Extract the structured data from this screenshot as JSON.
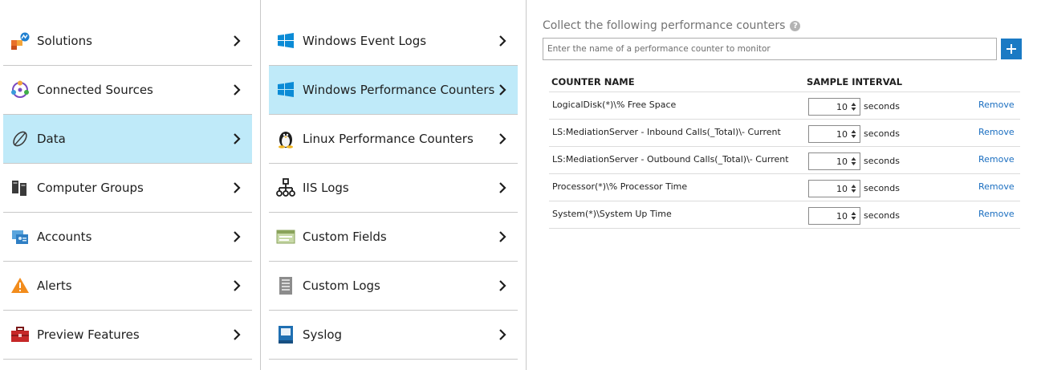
{
  "left_menu": {
    "items": [
      {
        "label": "Solutions",
        "icon": "solutions-icon"
      },
      {
        "label": "Connected Sources",
        "icon": "connected-sources-icon"
      },
      {
        "label": "Data",
        "icon": "data-icon",
        "selected": true
      },
      {
        "label": "Computer Groups",
        "icon": "computer-groups-icon"
      },
      {
        "label": "Accounts",
        "icon": "accounts-icon"
      },
      {
        "label": "Alerts",
        "icon": "alerts-icon"
      },
      {
        "label": "Preview Features",
        "icon": "preview-features-icon"
      }
    ]
  },
  "data_menu": {
    "items": [
      {
        "label": "Windows Event Logs",
        "icon": "windows-logo-icon"
      },
      {
        "label": "Windows Performance Counters",
        "icon": "windows-logo-icon",
        "selected": true
      },
      {
        "label": "Linux Performance Counters",
        "icon": "linux-penguin-icon"
      },
      {
        "label": "IIS Logs",
        "icon": "iis-logs-icon"
      },
      {
        "label": "Custom Fields",
        "icon": "custom-fields-icon"
      },
      {
        "label": "Custom Logs",
        "icon": "custom-logs-icon"
      },
      {
        "label": "Syslog",
        "icon": "syslog-icon"
      }
    ]
  },
  "counters_panel": {
    "title": "Collect the following performance counters",
    "search_placeholder": "Enter the name of a performance counter to monitor",
    "add_label": "+",
    "columns": {
      "name": "COUNTER NAME",
      "interval": "SAMPLE INTERVAL"
    },
    "rows": [
      {
        "name": "LogicalDisk(*)\\% Free Space",
        "interval": "10",
        "unit": "seconds",
        "action": "Remove"
      },
      {
        "name": "LS:MediationServer - Inbound Calls(_Total)\\- Current",
        "interval": "10",
        "unit": "seconds",
        "action": "Remove"
      },
      {
        "name": "LS:MediationServer - Outbound Calls(_Total)\\- Current",
        "interval": "10",
        "unit": "seconds",
        "action": "Remove"
      },
      {
        "name": "Processor(*)\\% Processor Time",
        "interval": "10",
        "unit": "seconds",
        "action": "Remove"
      },
      {
        "name": "System(*)\\System Up Time",
        "interval": "10",
        "unit": "seconds",
        "action": "Remove"
      }
    ]
  },
  "colors": {
    "accent": "#1a7ac4",
    "selected_bg": "#bfeaf9",
    "link": "#1a6ec0"
  }
}
